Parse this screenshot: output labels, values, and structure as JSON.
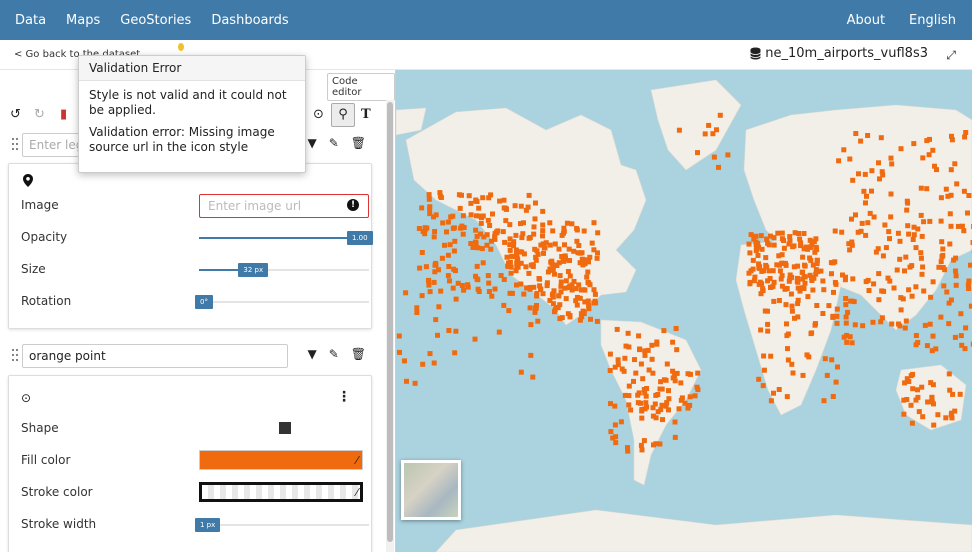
{
  "nav": {
    "left": [
      "Data",
      "Maps",
      "GeoStories",
      "Dashboards"
    ],
    "right": [
      "About",
      "English"
    ]
  },
  "subbar": {
    "back_label": "< Go back to the dataset",
    "dataset_name": "ne_10m_airports_vufl8s3"
  },
  "panel": {
    "code_editor_label": "Code editor",
    "rule1": {
      "legend_placeholder": "Enter legend label",
      "image_label": "Image",
      "image_placeholder": "Enter image url",
      "opacity_label": "Opacity",
      "opacity_value": "1.00",
      "opacity_fraction": 1.0,
      "size_label": "Size",
      "size_value": "32 px",
      "size_fraction": 0.32,
      "rotation_label": "Rotation",
      "rotation_value": "0°",
      "rotation_fraction": 0.0
    },
    "rule2": {
      "name": "orange point",
      "shape_label": "Shape",
      "fill_label": "Fill color",
      "fill_color": "#f06a0f",
      "stroke_label": "Stroke color",
      "stroke_color": "#111111",
      "stroke_width_label": "Stroke width",
      "stroke_width_value": "1 px",
      "stroke_width_fraction": 0.05
    }
  },
  "tooltip": {
    "title": "Validation Error",
    "message1": "Style is not valid and it could not be applied.",
    "message2": "Validation error: Missing image source url in the icon style"
  },
  "colors": {
    "brand": "#3f7aa8",
    "point": "#f06a0f",
    "water": "#aad3df",
    "land": "#f2efe9"
  }
}
